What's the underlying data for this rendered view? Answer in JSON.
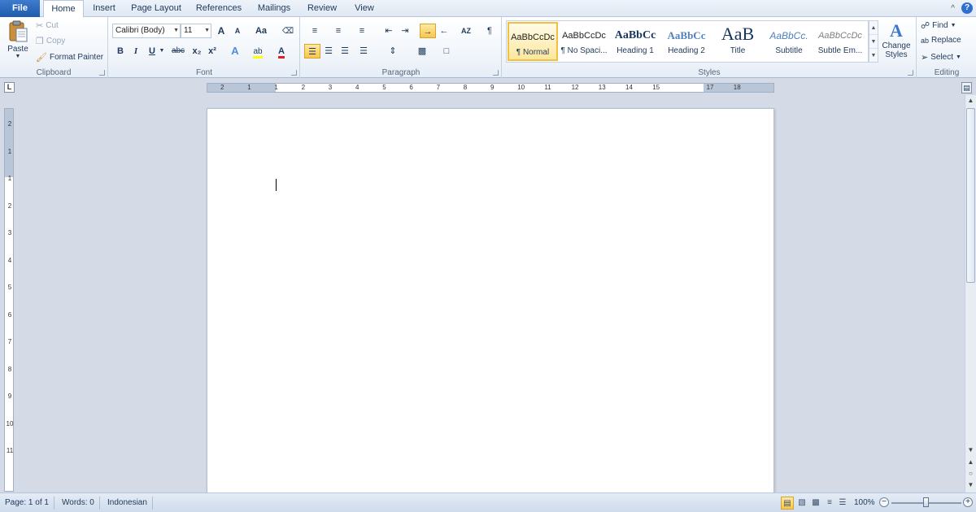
{
  "tabs": {
    "file": "File",
    "home": "Home",
    "insert": "Insert",
    "page_layout": "Page Layout",
    "references": "References",
    "mailings": "Mailings",
    "review": "Review",
    "view": "View"
  },
  "help_glyph": "?",
  "clipboard": {
    "paste": "Paste",
    "cut": "Cut",
    "copy": "Copy",
    "format_painter": "Format Painter",
    "label": "Clipboard"
  },
  "font": {
    "font_name": "Calibri (Body)",
    "font_size": "11",
    "grow": "A",
    "shrink": "A",
    "change_case": "Aa",
    "bold": "B",
    "italic": "I",
    "underline": "U",
    "strike": "abc",
    "subscript": "x₂",
    "superscript": "x²",
    "label": "Font"
  },
  "paragraph": {
    "label": "Paragraph",
    "show_marks": "¶"
  },
  "styles": {
    "label": "Styles",
    "items": [
      {
        "preview": "AaBbCcDc",
        "name": "¶ Normal"
      },
      {
        "preview": "AaBbCcDc",
        "name": "¶ No Spaci..."
      },
      {
        "preview": "AaBbCc",
        "name": "Heading 1"
      },
      {
        "preview": "AaBbCc",
        "name": "Heading 2"
      },
      {
        "preview": "AaB",
        "name": "Title"
      },
      {
        "preview": "AaBbCc.",
        "name": "Subtitle"
      },
      {
        "preview": "AaBbCcDc",
        "name": "Subtle Em..."
      }
    ],
    "change_styles_line1": "Change",
    "change_styles_line2": "Styles"
  },
  "editing": {
    "find": "Find",
    "replace": "Replace",
    "select": "Select",
    "label": "Editing"
  },
  "ruler": {
    "tab_selector": "L",
    "h_numbers": [
      "2",
      "1",
      "1",
      "2",
      "3",
      "4",
      "5",
      "6",
      "7",
      "8",
      "9",
      "10",
      "11",
      "12",
      "13",
      "14",
      "15",
      "17",
      "18"
    ],
    "v_numbers": [
      "2",
      "1",
      "1",
      "2",
      "3",
      "4",
      "5",
      "6",
      "7",
      "8",
      "9",
      "10",
      "11"
    ]
  },
  "status": {
    "page": "Page: 1 of 1",
    "words": "Words: 0",
    "language": "Indonesian",
    "zoom": "100%",
    "zoom_level_percent": 100
  },
  "colors": {
    "accent": "#2b579a",
    "file_tab": "#2a66bd",
    "highlight_yellow": "#ffff00",
    "font_red": "#e02020",
    "active_button": "#f8c64a"
  }
}
